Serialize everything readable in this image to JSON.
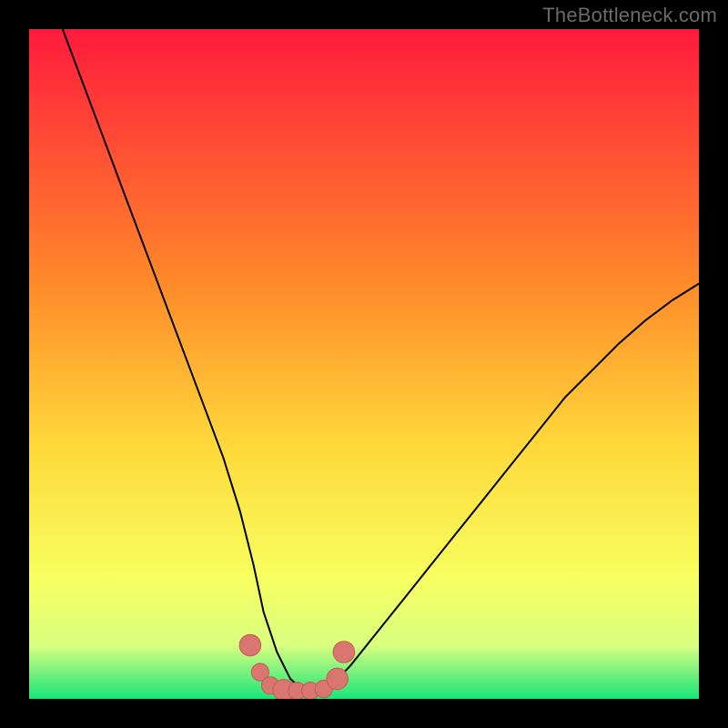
{
  "watermark": {
    "text": "TheBottleneck.com"
  },
  "colors": {
    "frame": "#000000",
    "curve": "#000000",
    "marker_fill": "#d8766f",
    "marker_stroke": "#c85a52",
    "gradient_top": "#ff1a3c",
    "gradient_mid1": "#ff6a2a",
    "gradient_mid2": "#ffd83a",
    "gradient_mid3": "#f8ff60",
    "gradient_mid4": "#d8ff80",
    "gradient_bottom": "#19e57a"
  },
  "chart_data": {
    "type": "line",
    "title": "",
    "xlabel": "",
    "ylabel": "",
    "xlim": [
      0,
      100
    ],
    "ylim": [
      0,
      100
    ],
    "grid": false,
    "legend": false,
    "series": [
      {
        "name": "bottleneck-curve",
        "x": [
          5,
          8,
          11,
          14,
          17,
          20,
          23,
          26,
          29,
          31.5,
          33.5,
          35,
          37,
          39,
          41,
          43,
          45,
          48,
          52,
          56,
          60,
          64,
          68,
          72,
          76,
          80,
          84,
          88,
          92,
          96,
          100
        ],
        "y": [
          100,
          92,
          84,
          76,
          68,
          60,
          52,
          44,
          36,
          28,
          20,
          13,
          7,
          3,
          1.2,
          1.2,
          1.8,
          5,
          10,
          15,
          20,
          25,
          30,
          35,
          40,
          45,
          49,
          53,
          56.5,
          59.5,
          62
        ]
      }
    ],
    "markers": {
      "name": "valley-highlight",
      "points": [
        {
          "x": 33.0,
          "y": 8.0,
          "r": 1.6
        },
        {
          "x": 34.5,
          "y": 4.0,
          "r": 1.3
        },
        {
          "x": 36.0,
          "y": 2.0,
          "r": 1.3
        },
        {
          "x": 38.0,
          "y": 1.3,
          "r": 1.6
        },
        {
          "x": 40.0,
          "y": 1.2,
          "r": 1.3
        },
        {
          "x": 42.0,
          "y": 1.2,
          "r": 1.3
        },
        {
          "x": 44.0,
          "y": 1.5,
          "r": 1.3
        },
        {
          "x": 46.0,
          "y": 3.0,
          "r": 1.6
        },
        {
          "x": 47.0,
          "y": 7.0,
          "r": 1.6
        }
      ]
    }
  }
}
